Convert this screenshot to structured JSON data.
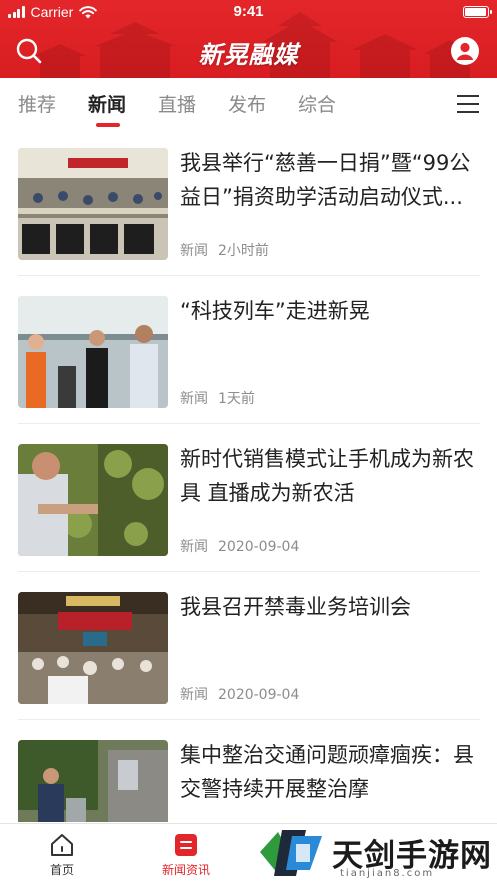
{
  "status_bar": {
    "carrier": "Carrier",
    "time": "9:41",
    "battery_level": 1.0
  },
  "header": {
    "brand": "新晃融媒",
    "search_icon": "search-icon",
    "user_icon": "user-icon"
  },
  "tabs": [
    {
      "label": "推荐",
      "active": false
    },
    {
      "label": "新闻",
      "active": true
    },
    {
      "label": "直播",
      "active": false
    },
    {
      "label": "发布",
      "active": false
    },
    {
      "label": "综合",
      "active": false
    }
  ],
  "menu_icon": "hamburger-menu-icon",
  "news": [
    {
      "title": "我县举行“慈善一日捐”暨“99公益日”捐资助学活动启动仪式...",
      "category": "新闻",
      "time": "2小时前"
    },
    {
      "title": "“科技列车”走进新晃",
      "category": "新闻",
      "time": "1天前"
    },
    {
      "title": "新时代销售模式让手机成为新农具 直播成为新农活",
      "category": "新闻",
      "time": "2020-09-04"
    },
    {
      "title": "我县召开禁毒业务培训会",
      "category": "新闻",
      "time": "2020-09-04"
    },
    {
      "title": "集中整治交通问题顽瘴痼疾：县交警持续开展整治摩",
      "category": "",
      "time": ""
    }
  ],
  "bottom_nav": [
    {
      "label": "首页",
      "icon": "home-icon",
      "active": false
    },
    {
      "label": "新闻资讯",
      "icon": "news-icon",
      "active": true
    }
  ],
  "watermark": {
    "text": "天剑手游网",
    "sub": "tianjian8.com"
  },
  "colors": {
    "brand_red": "#e3262a",
    "text": "#222222",
    "meta": "#8d8d8d"
  }
}
